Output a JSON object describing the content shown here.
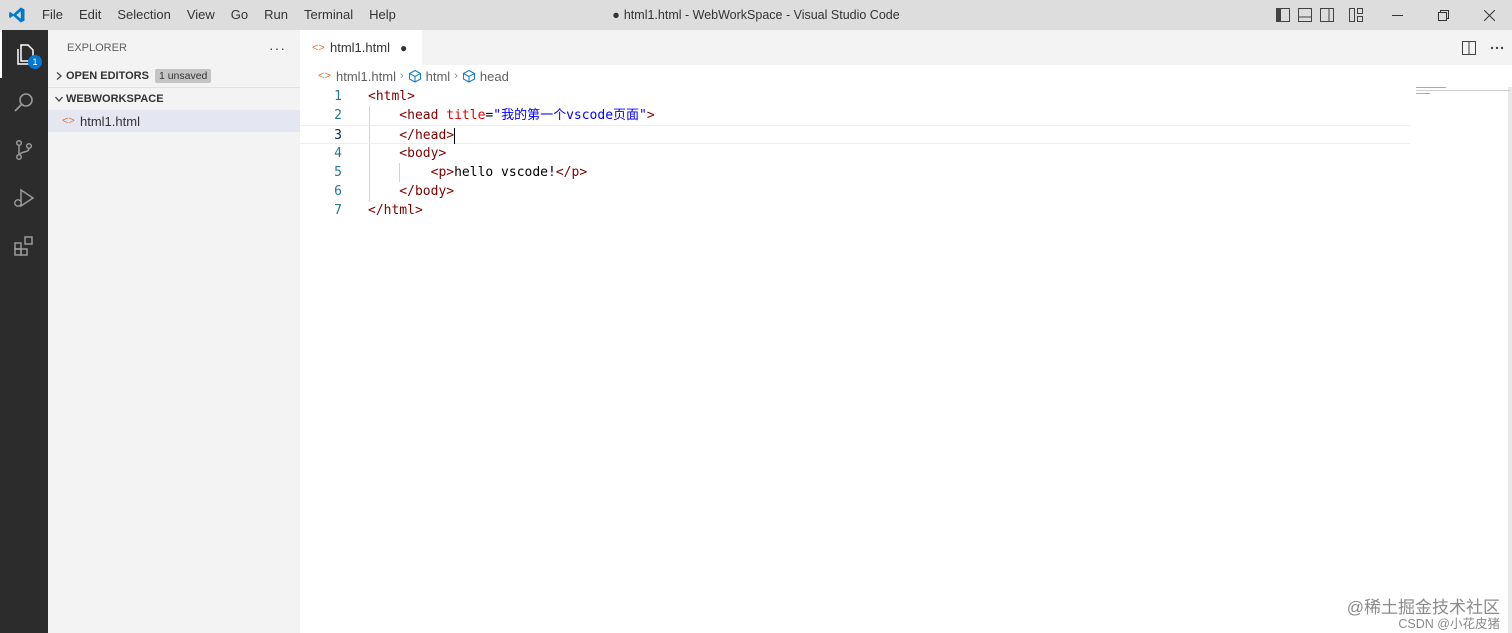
{
  "titlebar": {
    "menu": [
      "File",
      "Edit",
      "Selection",
      "View",
      "Go",
      "Run",
      "Terminal",
      "Help"
    ],
    "window_title": "html1.html - WebWorkSpace - Visual Studio Code",
    "dirty_marker": "●"
  },
  "activitybar": {
    "items": [
      "explorer-icon",
      "search-icon",
      "source-control-icon",
      "run-debug-icon",
      "extensions-icon"
    ],
    "explorer_badge": "1"
  },
  "sidebar": {
    "title": "EXPLORER",
    "more": "···",
    "open_editors": {
      "label": "OPEN EDITORS",
      "badge": "1 unsaved"
    },
    "workspace": {
      "label": "WEBWORKSPACE"
    },
    "files": [
      {
        "name": "html1.html",
        "icon": "html-file-icon"
      }
    ]
  },
  "editor": {
    "tab": {
      "label": "html1.html",
      "dirty": "●"
    },
    "breadcrumb": [
      "html1.html",
      "html",
      "head"
    ],
    "current_line": 3,
    "lines": [
      {
        "n": "1",
        "parts": [
          {
            "t": "tag",
            "v": "<html>"
          }
        ]
      },
      {
        "n": "2",
        "parts": [
          {
            "t": "tag",
            "v": "    <head "
          },
          {
            "t": "attr",
            "v": "title"
          },
          {
            "t": "txt",
            "v": "="
          },
          {
            "t": "str",
            "v": "\"我的第一个vscode页面\""
          },
          {
            "t": "tag",
            "v": ">"
          }
        ]
      },
      {
        "n": "3",
        "parts": [
          {
            "t": "tag",
            "v": "    </head>"
          }
        ]
      },
      {
        "n": "4",
        "parts": [
          {
            "t": "tag",
            "v": "    <body>"
          }
        ]
      },
      {
        "n": "5",
        "parts": [
          {
            "t": "tag",
            "v": "        <p>"
          },
          {
            "t": "txt",
            "v": "hello vscode!"
          },
          {
            "t": "tag",
            "v": "</p>"
          }
        ]
      },
      {
        "n": "6",
        "parts": [
          {
            "t": "tag",
            "v": "    </body>"
          }
        ]
      },
      {
        "n": "7",
        "parts": [
          {
            "t": "tag",
            "v": "</html>"
          }
        ]
      }
    ]
  },
  "watermark": {
    "line1": "@稀土掘金技术社区",
    "line2": "CSDN @小花皮猪"
  },
  "colors": {
    "activitybar": "#2c2c2c",
    "sidebar": "#f3f3f3",
    "titlebar": "#dddddd",
    "accent": "#0078d4"
  }
}
